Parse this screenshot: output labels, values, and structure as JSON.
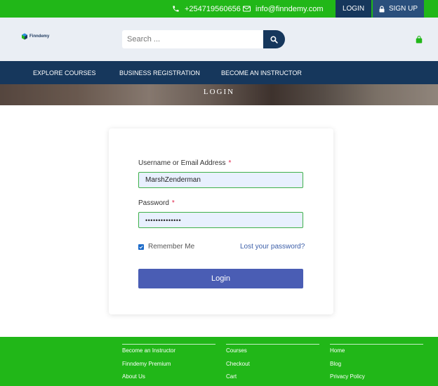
{
  "topbar": {
    "phone": "+254719560656",
    "email": "info@finndemy.com",
    "login_label": "LOGIN",
    "signup_label": "SIGN UP"
  },
  "header": {
    "logo_text": "Finndemy",
    "search_placeholder": "Search ...",
    "search_value": ""
  },
  "nav": {
    "items": [
      {
        "label": "EXPLORE COURSES"
      },
      {
        "label": "BUSINESS REGISTRATION"
      },
      {
        "label": "BECOME AN INSTRUCTOR"
      }
    ]
  },
  "hero": {
    "title": "LOGIN"
  },
  "form": {
    "username_label": "Username or Email Address",
    "username_value": "MarshZenderman",
    "password_label": "Password",
    "password_value": "••••••••••••••",
    "required_marker": "*",
    "remember_label": "Remember Me",
    "remember_checked": true,
    "lost_password_label": "Lost your password?",
    "submit_label": "Login"
  },
  "footer": {
    "columns": [
      {
        "links": [
          "Become an Instructor",
          "Finndemy Premium",
          "About Us"
        ]
      },
      {
        "links": [
          "Courses",
          "Checkout",
          "Cart"
        ]
      },
      {
        "links": [
          "Home",
          "Blog",
          "Privacy Policy"
        ]
      }
    ]
  },
  "colors": {
    "brand_green": "#21b718",
    "navy": "#16375c",
    "button_blue": "#4a5db4",
    "field_border": "#3fb14a",
    "required_red": "#e0244a"
  },
  "icons": [
    "phone-icon",
    "envelope-icon",
    "lock-icon",
    "logo-icon",
    "search-icon",
    "shopping-bag-icon",
    "checkbox-checked-icon"
  ]
}
